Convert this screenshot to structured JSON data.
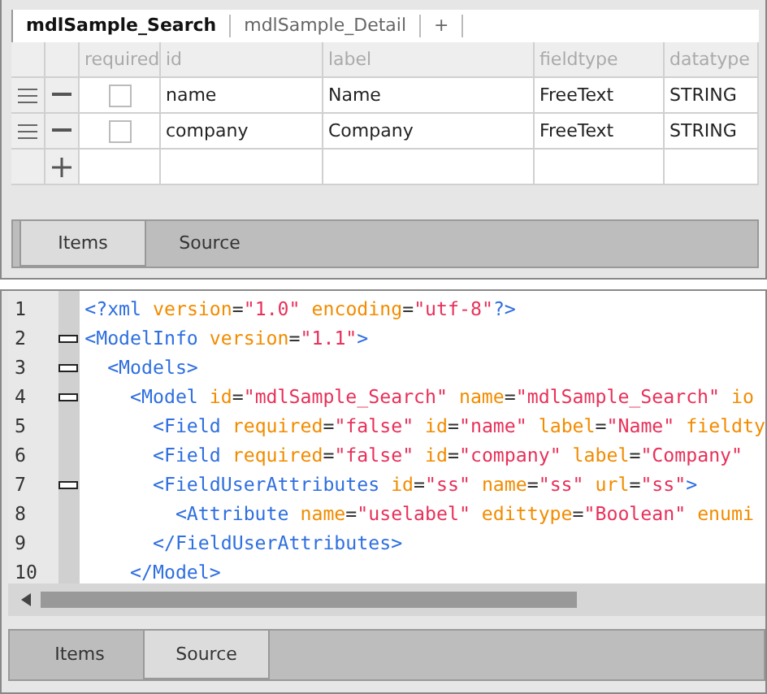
{
  "model_tabs": [
    {
      "label": "mdlSample_Search",
      "selected": true
    },
    {
      "label": "mdlSample_Detail",
      "selected": false
    },
    {
      "label": "+",
      "selected": false
    }
  ],
  "table": {
    "columns": [
      "required",
      "id",
      "label",
      "fieldtype",
      "datatype"
    ],
    "rows": [
      {
        "required": false,
        "id": "name",
        "label": "Name",
        "fieldtype": "FreeText",
        "datatype": "STRING"
      },
      {
        "required": false,
        "id": "company",
        "label": "Company",
        "fieldtype": "FreeText",
        "datatype": "STRING"
      }
    ]
  },
  "top_view_tabs": [
    {
      "label": "Items",
      "selected": true
    },
    {
      "label": "Source",
      "selected": false
    }
  ],
  "editor": {
    "lines": [
      {
        "number": "1",
        "foldable": false,
        "tokens": [
          {
            "kind": "tag",
            "text": "<?xml "
          },
          {
            "kind": "attr",
            "text": "version"
          },
          {
            "kind": "punct",
            "text": "="
          },
          {
            "kind": "value",
            "text": "\"1.0\" "
          },
          {
            "kind": "attr",
            "text": "encoding"
          },
          {
            "kind": "punct",
            "text": "="
          },
          {
            "kind": "value",
            "text": "\"utf-8\""
          },
          {
            "kind": "tag",
            "text": "?>"
          }
        ]
      },
      {
        "number": "2",
        "foldable": true,
        "tokens": [
          {
            "kind": "tag",
            "text": "<ModelInfo "
          },
          {
            "kind": "attr",
            "text": "version"
          },
          {
            "kind": "punct",
            "text": "="
          },
          {
            "kind": "value",
            "text": "\"1.1\""
          },
          {
            "kind": "tag",
            "text": ">"
          }
        ]
      },
      {
        "number": "3",
        "foldable": true,
        "tokens": [
          {
            "kind": "tag",
            "text": "  <Models>"
          }
        ]
      },
      {
        "number": "4",
        "foldable": true,
        "tokens": [
          {
            "kind": "tag",
            "text": "    <Model "
          },
          {
            "kind": "attr",
            "text": "id"
          },
          {
            "kind": "punct",
            "text": "="
          },
          {
            "kind": "value",
            "text": "\"mdlSample_Search\" "
          },
          {
            "kind": "attr",
            "text": "name"
          },
          {
            "kind": "punct",
            "text": "="
          },
          {
            "kind": "value",
            "text": "\"mdlSample_Search\" "
          },
          {
            "kind": "attr",
            "text": "io"
          }
        ]
      },
      {
        "number": "5",
        "foldable": false,
        "tokens": [
          {
            "kind": "tag",
            "text": "      <Field "
          },
          {
            "kind": "attr",
            "text": "required"
          },
          {
            "kind": "punct",
            "text": "="
          },
          {
            "kind": "value",
            "text": "\"false\" "
          },
          {
            "kind": "attr",
            "text": "id"
          },
          {
            "kind": "punct",
            "text": "="
          },
          {
            "kind": "value",
            "text": "\"name\" "
          },
          {
            "kind": "attr",
            "text": "label"
          },
          {
            "kind": "punct",
            "text": "="
          },
          {
            "kind": "value",
            "text": "\"Name\" "
          },
          {
            "kind": "attr",
            "text": "fieldty"
          }
        ]
      },
      {
        "number": "6",
        "foldable": false,
        "tokens": [
          {
            "kind": "tag",
            "text": "      <Field "
          },
          {
            "kind": "attr",
            "text": "required"
          },
          {
            "kind": "punct",
            "text": "="
          },
          {
            "kind": "value",
            "text": "\"false\" "
          },
          {
            "kind": "attr",
            "text": "id"
          },
          {
            "kind": "punct",
            "text": "="
          },
          {
            "kind": "value",
            "text": "\"company\" "
          },
          {
            "kind": "attr",
            "text": "label"
          },
          {
            "kind": "punct",
            "text": "="
          },
          {
            "kind": "value",
            "text": "\"Company\""
          }
        ]
      },
      {
        "number": "7",
        "foldable": true,
        "tokens": [
          {
            "kind": "tag",
            "text": "      <FieldUserAttributes "
          },
          {
            "kind": "attr",
            "text": "id"
          },
          {
            "kind": "punct",
            "text": "="
          },
          {
            "kind": "value",
            "text": "\"ss\" "
          },
          {
            "kind": "attr",
            "text": "name"
          },
          {
            "kind": "punct",
            "text": "="
          },
          {
            "kind": "value",
            "text": "\"ss\" "
          },
          {
            "kind": "attr",
            "text": "url"
          },
          {
            "kind": "punct",
            "text": "="
          },
          {
            "kind": "value",
            "text": "\"ss\""
          },
          {
            "kind": "tag",
            "text": ">"
          }
        ]
      },
      {
        "number": "8",
        "foldable": false,
        "tokens": [
          {
            "kind": "tag",
            "text": "        <Attribute "
          },
          {
            "kind": "attr",
            "text": "name"
          },
          {
            "kind": "punct",
            "text": "="
          },
          {
            "kind": "value",
            "text": "\"uselabel\" "
          },
          {
            "kind": "attr",
            "text": "edittype"
          },
          {
            "kind": "punct",
            "text": "="
          },
          {
            "kind": "value",
            "text": "\"Boolean\" "
          },
          {
            "kind": "attr",
            "text": "enumi"
          }
        ]
      },
      {
        "number": "9",
        "foldable": false,
        "tokens": [
          {
            "kind": "tag",
            "text": "      </FieldUserAttributes>"
          }
        ]
      },
      {
        "number": "10",
        "foldable": false,
        "tokens": [
          {
            "kind": "tag",
            "text": "    </Model>"
          }
        ]
      }
    ]
  },
  "bottom_view_tabs": [
    {
      "label": "Items",
      "selected": false
    },
    {
      "label": "Source",
      "selected": true
    }
  ]
}
